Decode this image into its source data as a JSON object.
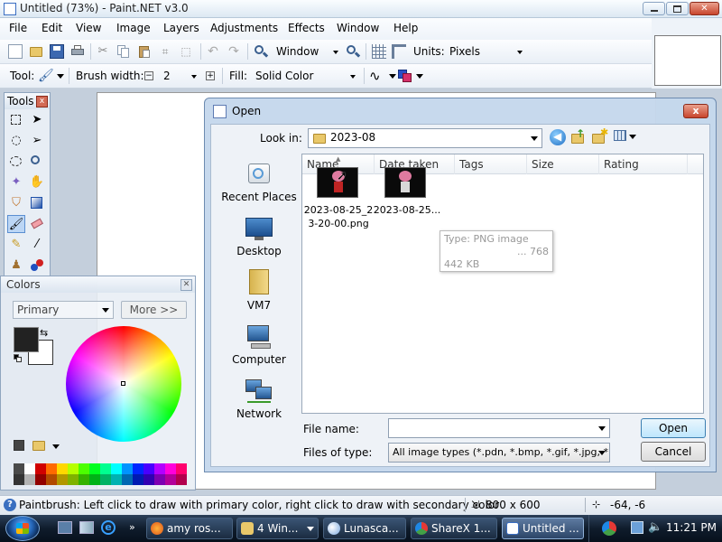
{
  "window": {
    "title": "Untitled (73%) - Paint.NET v3.0"
  },
  "menu": [
    "File",
    "Edit",
    "View",
    "Image",
    "Layers",
    "Adjustments",
    "Effects",
    "Window",
    "Help"
  ],
  "toolbar1": {
    "zoom_value": "Window",
    "units_label": "Units:",
    "units_value": "Pixels"
  },
  "toolbar2": {
    "tool_label": "Tool:",
    "brush_width_label": "Brush width:",
    "brush_width_value": "2",
    "fill_label": "Fill:",
    "fill_value": "Solid Color"
  },
  "tools_panel": {
    "title": "Tools",
    "close_label": "x"
  },
  "colors_panel": {
    "title": "Colors",
    "mode_value": "Primary",
    "more_label": "More >>",
    "primary_color": "#222222",
    "secondary_color": "#ffffff",
    "palette": [
      "#4a4a4a",
      "#ffffff",
      "#d00000",
      "#ff6a00",
      "#ffd800",
      "#b6ff00",
      "#4cff00",
      "#00ff21",
      "#00ff90",
      "#00ffff",
      "#0094ff",
      "#0026ff",
      "#4800ff",
      "#b200ff",
      "#ff00dc",
      "#ff006e"
    ]
  },
  "dialog": {
    "title": "Open",
    "close_label": "x",
    "look_in_label": "Look in:",
    "look_in_value": "2023-08",
    "places": [
      "Recent Places",
      "Desktop",
      "VM7",
      "Computer",
      "Network"
    ],
    "columns": [
      "Name",
      "Date taken",
      "Tags",
      "Size",
      "Rating"
    ],
    "files": [
      {
        "name": "2023-08-25_2 3-20-00.png"
      },
      {
        "name": "2023-08-25..."
      }
    ],
    "tooltip": {
      "line1": "Type: PNG image",
      "line2": "... 768",
      "line3": "442 KB"
    },
    "filename_label": "File name:",
    "filename_value": "",
    "filetype_label": "Files of type:",
    "filetype_value": "All image types (*.pdn, *.bmp, *.gif, *.jpg, *.jpeg,",
    "open_label": "Open",
    "cancel_label": "Cancel"
  },
  "status": {
    "hint": "Paintbrush: Left click to draw with primary color, right click to draw with secondary color",
    "image_size": "800 x 600",
    "cursor_pos": "-64, -6"
  },
  "taskbar": {
    "buttons": [
      "amy ros...",
      "4 Win...",
      "Lunasca...",
      "ShareX 1...",
      "Untitled ..."
    ],
    "time": "11:21 PM"
  }
}
